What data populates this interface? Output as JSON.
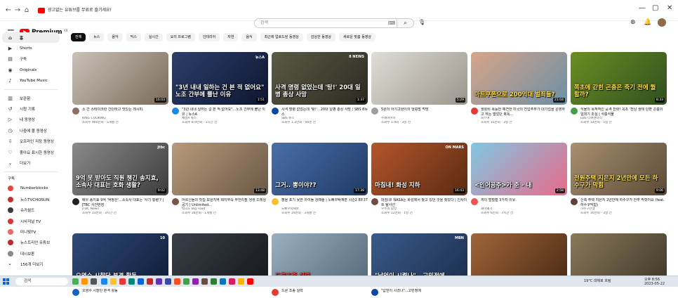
{
  "browser": {
    "ad_text": "광고없는 유튜브를 무료로 즐기세요!"
  },
  "header": {
    "logo_text": "Premium",
    "logo_region": "KR",
    "search_placeholder": "검색"
  },
  "sidebar": {
    "main": [
      {
        "label": "홈",
        "icon": "home-icon"
      },
      {
        "label": "Shorts",
        "icon": "shorts-icon"
      },
      {
        "label": "구독",
        "icon": "subscriptions-icon"
      },
      {
        "label": "Originals",
        "icon": "originals-icon"
      },
      {
        "label": "YouTube Music",
        "icon": "music-icon"
      }
    ],
    "library": [
      {
        "label": "보관함",
        "icon": "library-icon"
      },
      {
        "label": "시청 기록",
        "icon": "history-icon"
      },
      {
        "label": "내 동영상",
        "icon": "video-icon"
      },
      {
        "label": "나중에 볼 동영상",
        "icon": "clock-icon"
      },
      {
        "label": "오프라인 저장 동영상",
        "icon": "download-icon"
      },
      {
        "label": "좋아요 표시한 동영상",
        "icon": "like-icon"
      },
      {
        "label": "더보기",
        "icon": "chevron-down-icon"
      }
    ],
    "subs_heading": "구독",
    "subscriptions": [
      {
        "label": "Numberblocks",
        "color": "#e8453c"
      },
      {
        "label": "뉴스TVCHOSUN",
        "color": "#c4302b"
      },
      {
        "label": "슈카월드",
        "color": "#3a3a3a"
      },
      {
        "label": "시사저널 TV",
        "color": "#d33"
      },
      {
        "label": "미니빛TV",
        "color": "#e66"
      },
      {
        "label": "뉴스트리안 유튜브",
        "color": "#c62828"
      },
      {
        "label": "대시보론",
        "color": "#888"
      },
      {
        "label": "156개 더보기",
        "color": ""
      }
    ]
  },
  "chips": [
    "전체",
    "뉴스",
    "음악",
    "믹스",
    "실시간",
    "요리 프로그램",
    "인테리어",
    "자연",
    "음식",
    "최근에 업로드된 동영상",
    "감상한 동영상",
    "새로운 맞춤 동영상"
  ],
  "videos": [
    {
      "title": "소 간 스테이크란 간단하고 맛있는 레시피.",
      "channel": "KING COOKING",
      "stats": "조회수 940만회 · 5개월 전",
      "duration": "16:03",
      "caption": "",
      "tag": "",
      "bg": "linear-gradient(135deg,#c9c2b8,#7a6a5a)",
      "ch_color": "#8d6e63"
    },
    {
      "title": "\"3년 내내 일하는 걸 본 적 없어요\"...노조 간부에 뿔난 이유 | 뉴스A",
      "channel": "채널A 뉴스",
      "stats": "조회수 8.9만회 · 1시간 전",
      "duration": "1:51",
      "caption": "\"3년 내내 일하는 건 본 적 없어요\" 노조 간부에 뿔난 이유",
      "tag": "뉴스A",
      "bg": "linear-gradient(135deg,#2d3e6a,#0d1630)",
      "ch_color": "#1e88e5"
    },
    {
      "title": "사격 명령 없었는데 '탕!'...20대 일병 총상 사망 / SBS 8뉴스",
      "channel": "SBS 뉴스",
      "stats": "조회수 1.3만회 · 46분 전",
      "duration": "1:37",
      "caption": "사격 명령 없었는데 '탕!' 20대 일병 총상 사망",
      "tag": "8 NEWS",
      "bg": "linear-gradient(135deg,#5b5a45,#2c2a20)",
      "ch_color": "#0d47a1"
    },
    {
      "title": "5원이 아기고양이의 엉덩방 먹방",
      "channel": "주례바어이",
      "stats": "조회수 1.9회 · 3일 전",
      "duration": "5:29",
      "caption": "",
      "tag": "",
      "bg": "linear-gradient(135deg,#e0ddd6,#9a968c)",
      "ch_color": "#9e9e9e"
    },
    {
      "title": "생활비 폭등한 예견한 미국의 전업주부가 대기업을 운영하고 하는 벌었던 혹독...",
      "channel": "씨ㅇ여",
      "stats": "조회수 15만회 · 3일 전",
      "duration": "21:04",
      "caption": "마트쿠폰으로 200억대 벌죄들?",
      "tag": "",
      "bg": "linear-gradient(135deg,#d7a58a,#6b8fa5)",
      "ch_color": "#e53935"
    },
    {
      "title": "식물의 목적적인 공격 전략! 쪽초 '전남 생태 단편 곤충의 일대기 조심 | 식충식물",
      "channel": "EBS 다큐멘터리",
      "stats": "조회수 14만회 · 5일 전",
      "duration": "8:33",
      "caption": "쪽초에 갇힌 곤충은 죽기 전에 뭘 할까?",
      "tag": "",
      "bg": "linear-gradient(135deg,#6b8e23,#2f4f1f)",
      "ch_color": "#43a047"
    },
    {
      "title": "배우 송지효 9억 '억정산'...소속사 대표는 '사기 횡령'? | JTBC 사건반장",
      "channel": "JTBC News",
      "stats": "조회수 33만회 · 3시간 전",
      "duration": "9:02",
      "caption": "9억 못 받아도 직원 챙긴 송지효, 소속사 대표는 호화 생활?",
      "tag": "jtbc",
      "bg": "linear-gradient(135deg,#8a8a8a,#3c3c3c)",
      "ch_color": "#222"
    },
    {
      "title": "어르신들의 맛집 보완지역 돼지부속 무한리필 생생 드레싱 공기 | Unlimited...",
      "channel": "백곡도 Big Food",
      "stats": "조회수 38만회 · 1개월 전",
      "duration": "13:48",
      "caption": "",
      "tag": "",
      "bg": "linear-gradient(135deg,#b89a7a,#6b5846)",
      "ch_color": "#795548"
    },
    {
      "title": "뽕을 포기 못한 아이돌 강예술 | 노빠꾸탁재훈 시즌2 EP.37",
      "channel": "노빠꾸탁재훈",
      "stats": "조회수 19만회 · 3개월 전",
      "duration": "17:38",
      "caption": "그거.. 뽕이야??",
      "tag": "",
      "bg": "linear-gradient(135deg,#4a6ea8,#203a66)",
      "ch_color": "#fbc02d"
    },
    {
      "title": "마침내! NASA는 화성에서 찾고 있던 것을 찾았다 | 인사이트 탐사선",
      "channel": "우주의 탐방",
      "stats": "조회수 12만회 · 1일 전",
      "duration": "16:43",
      "caption": "마침내! 화성 지하",
      "tag": "ON MARS",
      "bg": "linear-gradient(135deg,#b4562a,#5a2a12)",
      "ch_color": "#6d4c41"
    },
    {
      "title": "게이 벌벌벌 3가지 이유.",
      "channel": "재미왜기",
      "stats": "조회수 6만회 · 7시간 전",
      "duration": "2:58",
      "caption": "<인어공주>가 준 - 내",
      "tag": "",
      "bg": "linear-gradient(135deg,#7ec8e3,#e86a8a)",
      "ch_color": "#ef5350"
    },
    {
      "title": "신축 주택 지은지 2년만에 하수구가 전부 막혔어요 (feat. 하수구막힘)",
      "channel": "하수구전쟁",
      "stats": "조회수 10만회 · 3일 전",
      "duration": "9:06",
      "caption": "전원주택 지은지 2년만에 모든 하수구가 막힘",
      "tag": "",
      "bg": "linear-gradient(135deg,#a89070,#5b4a36)",
      "ch_color": "#5d4037"
    },
    {
      "title": "오염수 시찰단 본격 활동",
      "channel": "",
      "stats": "",
      "duration": "",
      "caption": "오염수 시찰단 본격 활동",
      "tag": "10",
      "bg": "linear-gradient(135deg,#2f4a7a,#101c36)",
      "ch_color": "#1565c0"
    },
    {
      "title": "",
      "channel": "",
      "stats": "",
      "duration": "",
      "caption": "",
      "tag": "",
      "bg": "linear-gradient(135deg,#3a4048,#15181c)",
      "ch_color": "#555"
    },
    {
      "title": "드론 조종 실력",
      "channel": "",
      "stats": "",
      "duration": "",
      "caption": "드론조종 실력",
      "tag": "",
      "bg": "linear-gradient(135deg,#9ab0c0,#546a7a)",
      "ch_color": "#e53935"
    },
    {
      "title": "\"납얻이 시켰나\"...고민정에",
      "channel": "",
      "stats": "",
      "duration": "",
      "caption": "\"납얻이 시켰나\"...고민정에",
      "tag": "MBN",
      "bg": "linear-gradient(135deg,#3a5b8a,#1b2d4d)",
      "ch_color": "#0d47a1"
    },
    {
      "title": "",
      "channel": "",
      "stats": "",
      "duration": "",
      "caption": "",
      "tag": "",
      "bg": "linear-gradient(135deg,#a0653a,#4a2a14)",
      "ch_color": "#8d6e63"
    },
    {
      "title": "",
      "channel": "",
      "stats": "",
      "duration": "",
      "caption": "",
      "tag": "",
      "bg": "linear-gradient(135deg,#8a7a5a,#3e3628)",
      "ch_color": "#6d4c41"
    }
  ],
  "taskbar": {
    "search_label": "검색",
    "weather": "19°C 대체로 흐림",
    "time": "오후 8:56",
    "date": "2023-05-22"
  }
}
